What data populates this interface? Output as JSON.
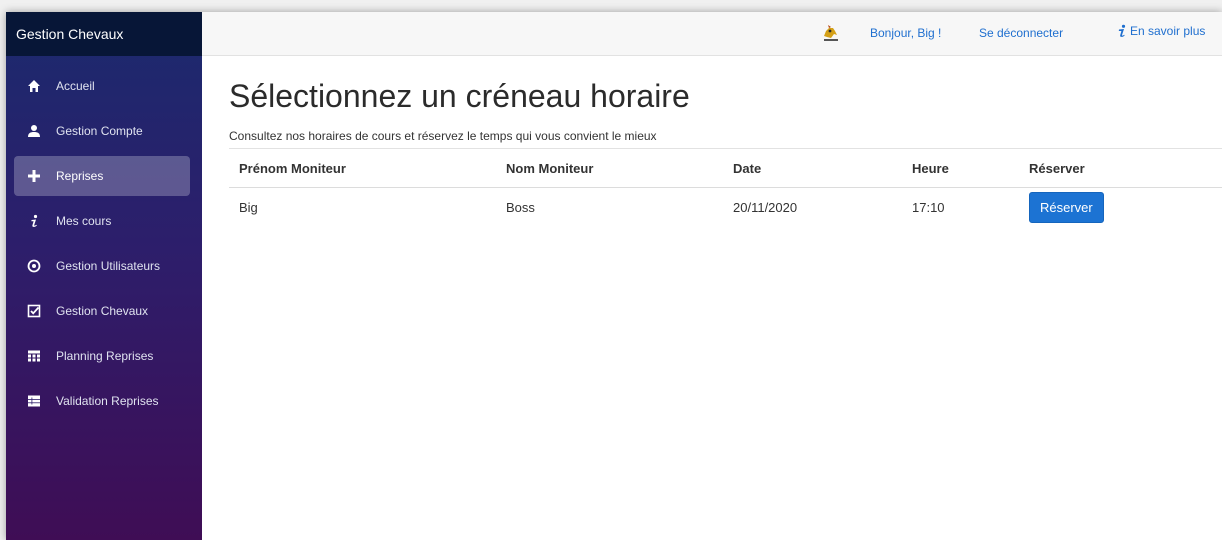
{
  "app": {
    "title": "Gestion Chevaux"
  },
  "sidebar": {
    "items": [
      {
        "label": "Accueil",
        "icon": "home-icon"
      },
      {
        "label": "Gestion Compte",
        "icon": "user-icon"
      },
      {
        "label": "Reprises",
        "icon": "plus-icon",
        "active": true
      },
      {
        "label": "Mes cours",
        "icon": "info-icon"
      },
      {
        "label": "Gestion Utilisateurs",
        "icon": "settings-circle-icon"
      },
      {
        "label": "Gestion Chevaux",
        "icon": "checkbox-icon"
      },
      {
        "label": "Planning Reprises",
        "icon": "calendar-icon"
      },
      {
        "label": "Validation Reprises",
        "icon": "list-icon"
      }
    ]
  },
  "header": {
    "greeting": "Bonjour, Big !",
    "logout": "Se déconnecter",
    "info": "En savoir plus"
  },
  "main": {
    "title": "Sélectionnez un créneau horaire",
    "subtitle": "Consultez nos horaires de cours et réservez le temps qui vous convient le mieux"
  },
  "table": {
    "columns": [
      "Prénom Moniteur",
      "Nom Moniteur",
      "Date",
      "Heure",
      "Réserver"
    ],
    "rows": [
      {
        "prenom": "Big",
        "nom": "Boss",
        "date": "20/11/2020",
        "heure": "17:10",
        "button": "Réserver"
      }
    ]
  },
  "colors": {
    "accent": "#1c73d3",
    "sidebar_header": "#071637",
    "sidebar_top": "#1b2a6e",
    "sidebar_bottom": "#3f0d55"
  }
}
